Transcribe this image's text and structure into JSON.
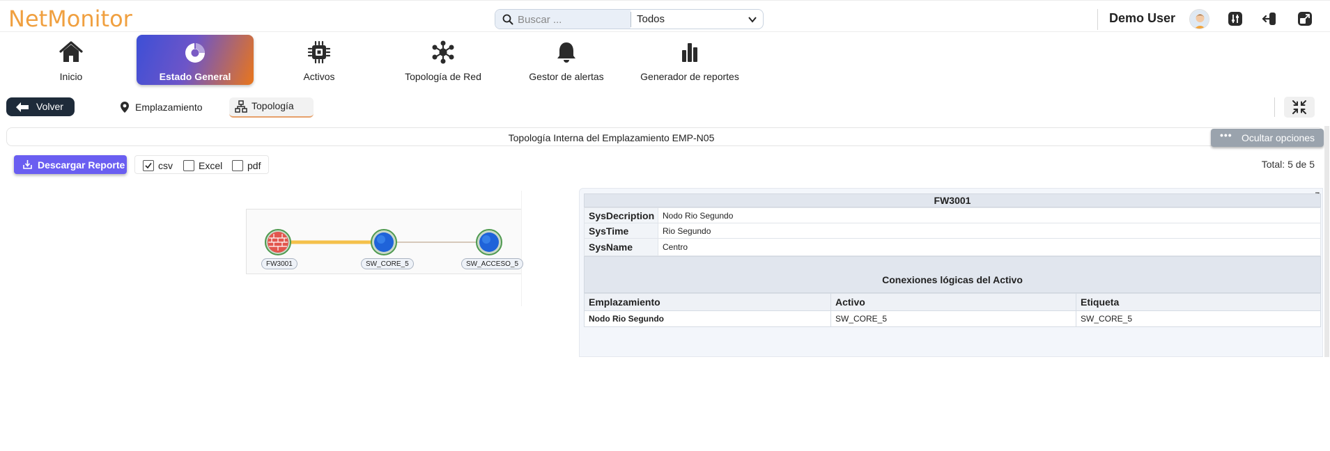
{
  "app": {
    "logo_text": "NetMonitor",
    "brand_color": "#f0a040"
  },
  "header": {
    "search": {
      "placeholder": "Buscar ...",
      "value": ""
    },
    "filter": {
      "selected": "Todos"
    },
    "user_name": "Demo User",
    "icons": [
      "search-icon",
      "chevron-down-icon",
      "avatar",
      "settings-sliders-icon",
      "logout-icon",
      "fullscreen-icon"
    ]
  },
  "nav": {
    "items": [
      {
        "label": "Inicio",
        "icon": "home-icon"
      },
      {
        "label": "Estado General",
        "icon": "dashboard-icon",
        "active": true
      },
      {
        "label": "Activos",
        "icon": "chip-icon"
      },
      {
        "label": "Topología de Red",
        "icon": "network-icon"
      },
      {
        "label": "Gestor de alertas",
        "icon": "bell-icon"
      },
      {
        "label": "Generador de reportes",
        "icon": "bar-chart-icon"
      }
    ]
  },
  "subnav": {
    "back_label": "Volver",
    "tabs": [
      {
        "label": "Emplazamiento",
        "icon": "location-pin-icon"
      },
      {
        "label": "Topología",
        "icon": "topology-icon",
        "active": true
      }
    ]
  },
  "view": {
    "title": "Topología Interna del Emplazamiento EMP-N05",
    "toggle_options_label": "Ocultar opciones",
    "download_label": "Descargar Reporte",
    "formats": [
      {
        "label": "csv",
        "checked": true
      },
      {
        "label": "Excel",
        "checked": false
      },
      {
        "label": "pdf",
        "checked": false
      }
    ],
    "total_text": "Total: 5 de 5"
  },
  "topology": {
    "nodes": [
      {
        "id": "FW3001",
        "type": "firewall"
      },
      {
        "id": "SW_CORE_5",
        "type": "switch"
      },
      {
        "id": "SW_ACCESO_5",
        "type": "switch"
      }
    ],
    "links": [
      {
        "from": "FW3001",
        "to": "SW_CORE_5",
        "color": "#f4c04a"
      },
      {
        "from": "SW_CORE_5",
        "to": "SW_ACCESO_5",
        "color": "#c9b8a4"
      }
    ]
  },
  "detail": {
    "asset_name": "FW3001",
    "properties": [
      {
        "key": "SysDecription",
        "value": "Nodo Rio Segundo"
      },
      {
        "key": "SysTime",
        "value": "Rio Segundo"
      },
      {
        "key": "SysName",
        "value": "Centro"
      }
    ],
    "connections_title": "Conexiones lógicas del Activo",
    "columns": [
      "Emplazamiento",
      "Activo",
      "Etiqueta"
    ],
    "rows": [
      [
        "Nodo Rio Segundo",
        "SW_CORE_5",
        "SW_CORE_5"
      ]
    ]
  }
}
